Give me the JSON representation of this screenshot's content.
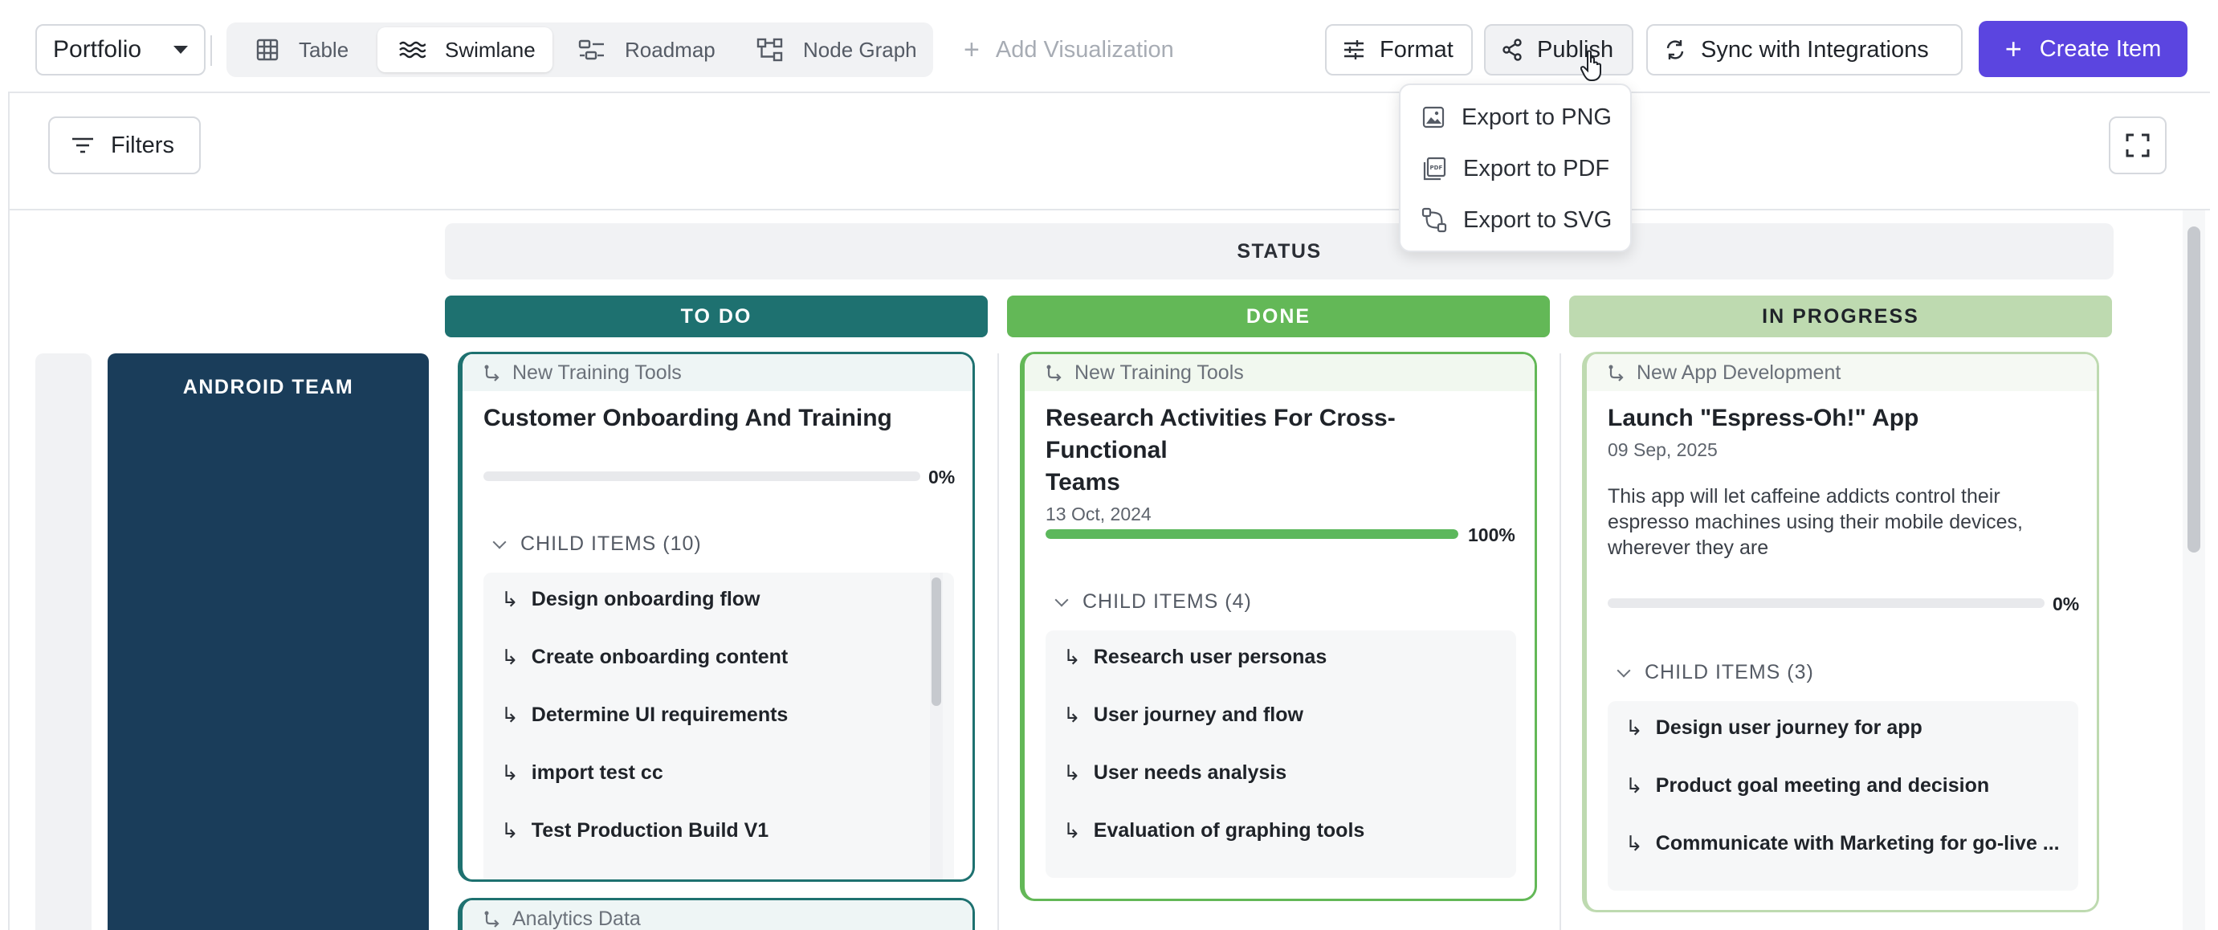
{
  "toolbar": {
    "portfolio_label": "Portfolio",
    "tabs": [
      {
        "label": "Table",
        "icon": "table-icon"
      },
      {
        "label": "Swimlane",
        "icon": "swimlane-icon"
      },
      {
        "label": "Roadmap",
        "icon": "roadmap-icon"
      },
      {
        "label": "Node Graph",
        "icon": "node-graph-icon"
      }
    ],
    "active_tab": "Swimlane",
    "add_visualization": "Add Visualization",
    "format": "Format",
    "publish": "Publish",
    "sync": "Sync with Integrations",
    "create": "Create Item"
  },
  "publish_menu": {
    "items": [
      "Export to PNG",
      "Export to PDF",
      "Export to SVG"
    ]
  },
  "filters": {
    "label": "Filters"
  },
  "board": {
    "group_header": "STATUS",
    "columns": [
      {
        "label": "TO DO",
        "color": "#1e7170",
        "text_color": "#ffffff"
      },
      {
        "label": "DONE",
        "color": "#63b857",
        "text_color": "#ffffff"
      },
      {
        "label": "IN PROGRESS",
        "color": "#bedab0",
        "text_color": "#1f2329"
      }
    ],
    "row_label": "ANDROID TEAM",
    "cards": [
      {
        "parent": "New Training Tools",
        "title": "Customer Onboarding And Training",
        "progress": 0,
        "progress_label": "0%",
        "child_header": "CHILD ITEMS (10)",
        "children": [
          "Design onboarding flow",
          "Create onboarding content",
          "Determine UI requirements",
          "import test cc",
          "Test Production Build V1"
        ],
        "border_color": "#1e7170"
      },
      {
        "parent": "New Training Tools",
        "title_line1": "Research Activities For Cross-Functional",
        "title_line2": "Teams",
        "date": "13 Oct, 2024",
        "progress": 100,
        "progress_label": "100%",
        "child_header": "CHILD ITEMS (4)",
        "children": [
          "Research user personas",
          "User journey and flow",
          "User needs analysis",
          "Evaluation of graphing tools"
        ],
        "border_color": "#63b857"
      },
      {
        "parent": "New App Development",
        "title": "Launch \"Espress-Oh!\" App",
        "date": "09 Sep, 2025",
        "description_lines": [
          "This app will let caffeine addicts control their",
          "espresso machines using their mobile devices,",
          "wherever they are"
        ],
        "progress": 0,
        "progress_label": "0%",
        "child_header": "CHILD ITEMS (3)",
        "children": [
          "Design user journey for app",
          "Product goal meeting and decision",
          "Communicate with Marketing for go-live ..."
        ],
        "border_color": "#bedab0"
      }
    ],
    "next_card_parent": "Analytics Data"
  },
  "colors": {
    "accent": "#5b45e0",
    "team_lane": "#1a3d5a"
  }
}
